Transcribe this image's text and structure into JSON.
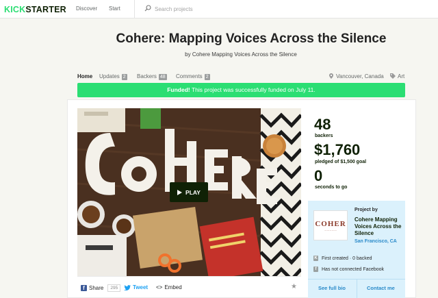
{
  "nav": {
    "logo_part1": "KICK",
    "logo_part2": "STARTER",
    "discover": "Discover",
    "start": "Start",
    "search_placeholder": "Search projects"
  },
  "project": {
    "title": "Cohere: Mapping Voices Across the Silence",
    "byline": "by Cohere Mapping Voices Across the Silence"
  },
  "tabs": [
    {
      "label": "Home",
      "count": ""
    },
    {
      "label": "Updates",
      "count": "2"
    },
    {
      "label": "Backers",
      "count": "48"
    },
    {
      "label": "Comments",
      "count": "2"
    }
  ],
  "meta": {
    "location": "Vancouver, Canada",
    "category": "Art"
  },
  "funded": {
    "strong": "Funded!",
    "text": " This project was successfully funded on July 11."
  },
  "video": {
    "play_label": "PLAY"
  },
  "share": {
    "facebook": "Share",
    "facebook_count": "295",
    "tweet": "Tweet",
    "embed": "Embed"
  },
  "stats": {
    "backers_num": "48",
    "backers_label": "backers",
    "pledged_num": "$1,760",
    "pledged_label": "pledged of $1,500 goal",
    "days_num": "0",
    "days_label": "seconds to go"
  },
  "creator": {
    "project_by": "Project by",
    "name": "Cohere Mapping Voices Across the Silence",
    "location": "San Francisco, CA",
    "thumb_text": "COHER",
    "first_created": "First created · 0 backed",
    "facebook_status": "Has not connected Facebook",
    "see_bio": "See full bio",
    "contact": "Contact me"
  },
  "colors": {
    "brand_green": "#2bde73",
    "brand_dark": "#0f2105",
    "link_blue": "#2a8ac9",
    "creator_bg": "#dbf1fc"
  }
}
